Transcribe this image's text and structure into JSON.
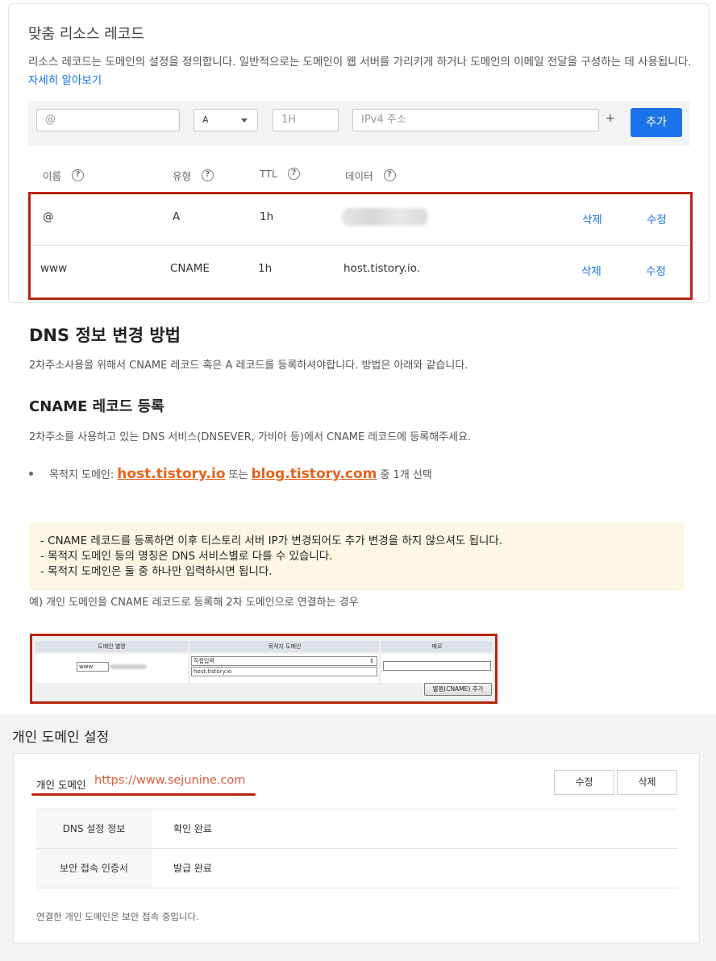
{
  "records": {
    "title": "맞춤 리소스 레코드",
    "description": "리소스 레코드는 도메인의 설정을 정의합니다. 일반적으로는 도메인이 웹 서버를 가리키게 하거나 도메인의 이메일 전달을 구성하는 데 사용됩니다.",
    "learn_more": "자세히 알아보기",
    "form": {
      "name_placeholder": "@",
      "type_value": "A",
      "ttl_placeholder": "1H",
      "data_placeholder": "IPv4 주소",
      "plus": "+",
      "add_label": "추가"
    },
    "headers": [
      "이름",
      "유형",
      "TTL",
      "데이터"
    ],
    "help_glyph": "?",
    "rows": [
      {
        "name": "@",
        "type": "A",
        "ttl": "1h",
        "data": "",
        "delete": "삭제",
        "edit": "수정"
      },
      {
        "name": "www",
        "type": "CNAME",
        "ttl": "1h",
        "data": "host.tistory.io.",
        "delete": "삭제",
        "edit": "수정"
      }
    ]
  },
  "guide": {
    "heading": "DNS 정보 변경 방법",
    "intro": "2차주소사용을 위해서 CNAME 레코드 혹은 A 레코드를 등록하셔야합니다. 방법은 아래와 같습니다.",
    "sub_heading": "CNAME 레코드 등록",
    "sub_text": "2차주소를 사용하고 있는 DNS 서비스(DNSEVER, 가비아 등)에서 CNAME 레코드에 등록해주세요.",
    "bullet_prefix": "목적지 도메인:",
    "bullet_link1": "host.tistory.io",
    "bullet_mid": "또는",
    "bullet_link2": "blog.tistory.com",
    "bullet_suffix": "중 1개 선택",
    "notes": [
      "- CNAME 레코드를 등록하면 이후 티스토리 서버 IP가 변경되어도 추가 변경을 하지 않으셔도 됩니다.",
      "- 목적지 도메인 등의 명칭은 DNS 서비스별로 다를 수 있습니다.",
      "- 목적지 도메인은 둘 중 하나만 입력하시면 됩니다."
    ],
    "example_caption": "예) 개인 도메인을 CNAME 레코드로 등록해 2차 도메인으로 연결하는 경우",
    "example": {
      "col1": "도메인 별명",
      "col2": "목적지 도메인",
      "col3": "메모",
      "alias_value": "www",
      "select_value": "직접입력",
      "select_arrow": "⇕",
      "dest_value": "host.tistory.io",
      "button": "별명(CNAME) 추가"
    }
  },
  "personal": {
    "section_title": "개인 도메인 설정",
    "domain_label": "개인 도메인",
    "domain_value": "https://www.sejunine.com",
    "edit_label": "수정",
    "delete_label": "삭제",
    "rows": [
      {
        "key": "DNS 설정 정보",
        "value": "확인 완료"
      },
      {
        "key": "보안 접속 인증서",
        "value": "발급 완료"
      }
    ],
    "footer": "연결한 개인 도메인은 보안 접속 중입니다."
  }
}
